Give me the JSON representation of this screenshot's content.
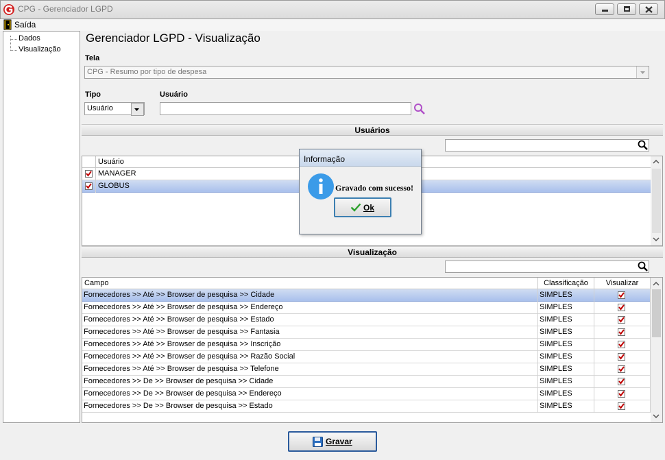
{
  "window": {
    "title": "CPG - Gerenciador LGPD"
  },
  "menu": {
    "exit_label": "Saída"
  },
  "tree": {
    "items": [
      "Dados",
      "Visualização"
    ]
  },
  "page": {
    "title": "Gerenciador LGPD - Visualização"
  },
  "tela": {
    "label": "Tela",
    "value": "CPG - Resumo por tipo de despesa"
  },
  "tipo": {
    "label": "Tipo",
    "value": "Usuário"
  },
  "usuario": {
    "label": "Usuário",
    "value": ""
  },
  "users_section": {
    "title": "Usuários",
    "search_value": "",
    "column": "Usuário",
    "rows": [
      {
        "name": "MANAGER",
        "checked": true,
        "selected": false
      },
      {
        "name": "GLOBUS",
        "checked": true,
        "selected": true
      }
    ]
  },
  "view_section": {
    "title": "Visualização",
    "search_value": "",
    "columns": [
      "Campo",
      "Classificação",
      "Visualizar"
    ],
    "rows": [
      {
        "campo": "Fornecedores >> Até >> Browser de pesquisa >> Cidade",
        "class": "SIMPLES",
        "visualizar": true,
        "selected": true
      },
      {
        "campo": "Fornecedores >> Até >> Browser de pesquisa >> Endereço",
        "class": "SIMPLES",
        "visualizar": true,
        "selected": false
      },
      {
        "campo": "Fornecedores >> Até >> Browser de pesquisa >> Estado",
        "class": "SIMPLES",
        "visualizar": true,
        "selected": false
      },
      {
        "campo": "Fornecedores >> Até >> Browser de pesquisa >> Fantasia",
        "class": "SIMPLES",
        "visualizar": true,
        "selected": false
      },
      {
        "campo": "Fornecedores >> Até >> Browser de pesquisa >> Inscrição",
        "class": "SIMPLES",
        "visualizar": true,
        "selected": false
      },
      {
        "campo": "Fornecedores >> Até >> Browser de pesquisa >> Razão Social",
        "class": "SIMPLES",
        "visualizar": true,
        "selected": false
      },
      {
        "campo": "Fornecedores >> Até >> Browser de pesquisa >> Telefone",
        "class": "SIMPLES",
        "visualizar": true,
        "selected": false
      },
      {
        "campo": "Fornecedores >> De >> Browser de pesquisa >> Cidade",
        "class": "SIMPLES",
        "visualizar": true,
        "selected": false
      },
      {
        "campo": "Fornecedores >> De >> Browser de pesquisa >> Endereço",
        "class": "SIMPLES",
        "visualizar": true,
        "selected": false
      },
      {
        "campo": "Fornecedores >> De >> Browser de pesquisa >> Estado",
        "class": "SIMPLES",
        "visualizar": true,
        "selected": false
      }
    ]
  },
  "dialog": {
    "title": "Informação",
    "message": "Gravado com sucesso!",
    "ok_label": "Ok"
  },
  "save_button": {
    "label": "Gravar"
  },
  "colors": {
    "check": "#c00000",
    "selection": "#a9c0ec",
    "info_icon": "#3b9be8",
    "search_icon": "#b050c8"
  },
  "icons": [
    "app-logo-icon",
    "exit-door-icon",
    "minimize-icon",
    "restore-icon",
    "close-icon",
    "search-icon",
    "info-icon",
    "checkmark-icon",
    "floppy-disk-icon"
  ]
}
